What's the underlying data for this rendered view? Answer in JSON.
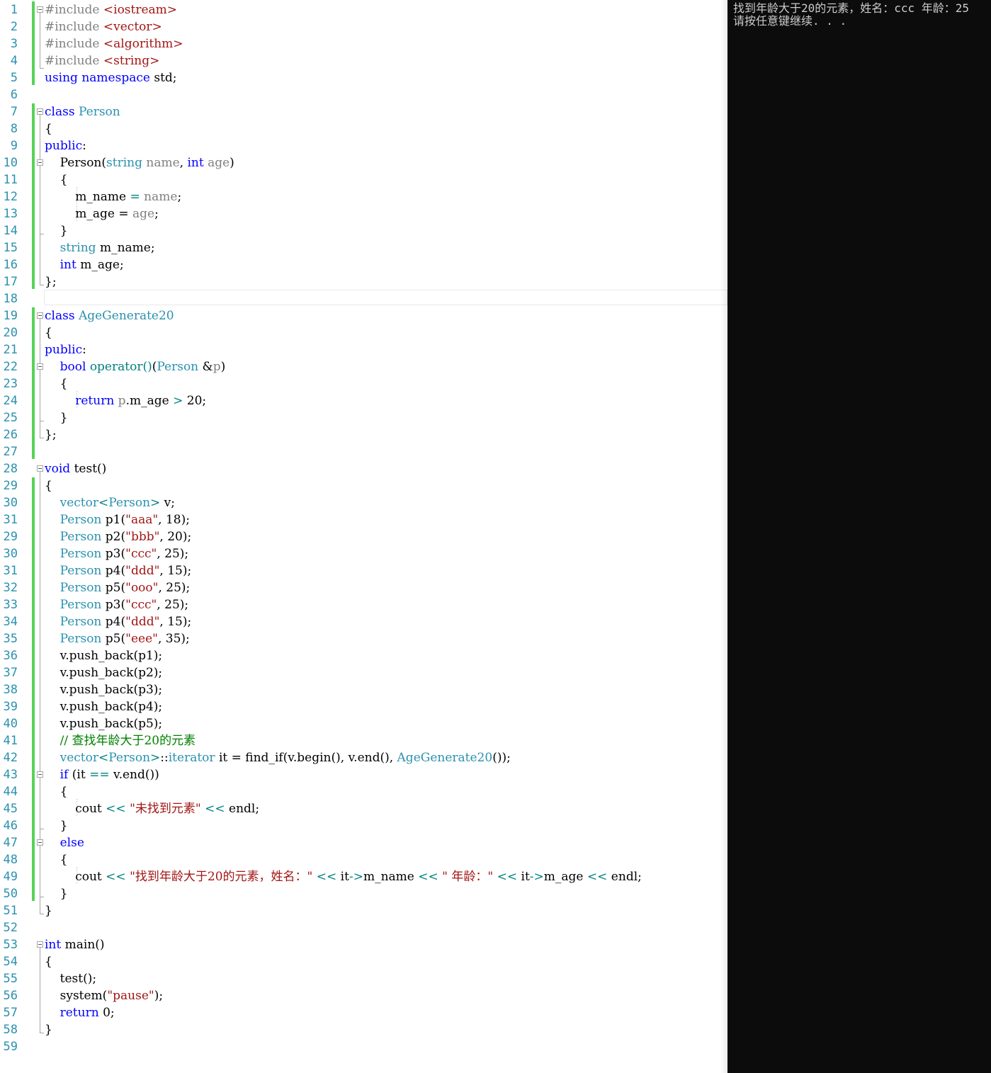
{
  "editor": {
    "lines": [
      {
        "num": "1",
        "tokens": [
          {
            "c": "pp",
            "t": "#include "
          },
          {
            "c": "inc",
            "t": "<iostream>"
          }
        ]
      },
      {
        "num": "2",
        "tokens": [
          {
            "c": "pp",
            "t": "#include "
          },
          {
            "c": "inc",
            "t": "<vector>"
          }
        ]
      },
      {
        "num": "3",
        "tokens": [
          {
            "c": "pp",
            "t": "#include "
          },
          {
            "c": "inc",
            "t": "<algorithm>"
          }
        ]
      },
      {
        "num": "4",
        "tokens": [
          {
            "c": "pp",
            "t": "#include "
          },
          {
            "c": "inc",
            "t": "<string>"
          }
        ]
      },
      {
        "num": "5",
        "tokens": [
          {
            "c": "kw",
            "t": "using namespace"
          },
          {
            "c": "pl",
            "t": " std;"
          }
        ]
      },
      {
        "num": "6",
        "tokens": []
      },
      {
        "num": "7",
        "tokens": [
          {
            "c": "kw",
            "t": "class "
          },
          {
            "c": "type",
            "t": "Person"
          }
        ]
      },
      {
        "num": "8",
        "tokens": [
          {
            "c": "pl",
            "t": "{"
          }
        ]
      },
      {
        "num": "9",
        "tokens": [
          {
            "c": "kw",
            "t": "public"
          },
          {
            "c": "pl",
            "t": ":"
          }
        ]
      },
      {
        "num": "10",
        "tokens": [
          {
            "c": "pl",
            "t": "    Person("
          },
          {
            "c": "type",
            "t": "string"
          },
          {
            "c": "par",
            "t": " name"
          },
          {
            "c": "pl",
            "t": ", "
          },
          {
            "c": "kw",
            "t": "int"
          },
          {
            "c": "par",
            "t": " age"
          },
          {
            "c": "pl",
            "t": ")"
          }
        ]
      },
      {
        "num": "11",
        "tokens": [
          {
            "c": "pl",
            "t": "    {"
          }
        ]
      },
      {
        "num": "12",
        "tokens": [
          {
            "c": "pl",
            "t": "        m_name "
          },
          {
            "c": "op",
            "t": "="
          },
          {
            "c": "par",
            "t": " name"
          },
          {
            "c": "pl",
            "t": ";"
          }
        ]
      },
      {
        "num": "13",
        "tokens": [
          {
            "c": "pl",
            "t": "        m_age = "
          },
          {
            "c": "par",
            "t": "age"
          },
          {
            "c": "pl",
            "t": ";"
          }
        ]
      },
      {
        "num": "14",
        "tokens": [
          {
            "c": "pl",
            "t": "    }"
          }
        ]
      },
      {
        "num": "15",
        "tokens": [
          {
            "c": "type",
            "t": "    string"
          },
          {
            "c": "pl",
            "t": " m_name;"
          }
        ]
      },
      {
        "num": "16",
        "tokens": [
          {
            "c": "kw",
            "t": "    int"
          },
          {
            "c": "pl",
            "t": " m_age;"
          }
        ]
      },
      {
        "num": "17",
        "tokens": [
          {
            "c": "pl",
            "t": "};"
          }
        ]
      },
      {
        "num": "18",
        "tokens": []
      },
      {
        "num": "19",
        "tokens": [
          {
            "c": "kw",
            "t": "class "
          },
          {
            "c": "type",
            "t": "AgeGenerate20"
          }
        ]
      },
      {
        "num": "20",
        "tokens": [
          {
            "c": "pl",
            "t": "{"
          }
        ]
      },
      {
        "num": "21",
        "tokens": [
          {
            "c": "kw",
            "t": "public"
          },
          {
            "c": "pl",
            "t": ":"
          }
        ]
      },
      {
        "num": "22",
        "tokens": [
          {
            "c": "kw",
            "t": "    bool"
          },
          {
            "c": "pl",
            "t": " "
          },
          {
            "c": "op",
            "t": "operator()"
          },
          {
            "c": "pl",
            "t": "("
          },
          {
            "c": "type",
            "t": "Person"
          },
          {
            "c": "pl",
            "t": " &"
          },
          {
            "c": "par",
            "t": "p"
          },
          {
            "c": "pl",
            "t": ")"
          }
        ]
      },
      {
        "num": "23",
        "tokens": [
          {
            "c": "pl",
            "t": "    {"
          }
        ]
      },
      {
        "num": "24",
        "tokens": [
          {
            "c": "kw",
            "t": "        return"
          },
          {
            "c": "par",
            "t": " p"
          },
          {
            "c": "pl",
            "t": ".m_age "
          },
          {
            "c": "op",
            "t": ">"
          },
          {
            "c": "pl",
            "t": " 20;"
          }
        ]
      },
      {
        "num": "25",
        "tokens": [
          {
            "c": "pl",
            "t": "    }"
          }
        ]
      },
      {
        "num": "26",
        "tokens": [
          {
            "c": "pl",
            "t": "};"
          }
        ]
      },
      {
        "num": "27",
        "tokens": []
      },
      {
        "num": "28",
        "tokens": [
          {
            "c": "kw",
            "t": "void"
          },
          {
            "c": "pl",
            "t": " test()"
          }
        ]
      },
      {
        "num": "29",
        "tokens": [
          {
            "c": "pl",
            "t": "{"
          }
        ]
      },
      {
        "num": "30",
        "tokens": [
          {
            "c": "type",
            "t": "    vector"
          },
          {
            "c": "op",
            "t": "<"
          },
          {
            "c": "type",
            "t": "Person"
          },
          {
            "c": "op",
            "t": ">"
          },
          {
            "c": "pl",
            "t": " v;"
          }
        ]
      },
      {
        "num": "31",
        "tokens": [
          {
            "c": "type",
            "t": "    Person"
          },
          {
            "c": "pl",
            "t": " p1("
          },
          {
            "c": "str",
            "t": "\"aaa\""
          },
          {
            "c": "pl",
            "t": ", 18);"
          }
        ]
      },
      {
        "num": "29",
        "tokens": [
          {
            "c": "type",
            "t": "    Person"
          },
          {
            "c": "pl",
            "t": " p2("
          },
          {
            "c": "str",
            "t": "\"bbb\""
          },
          {
            "c": "pl",
            "t": ", 20);"
          }
        ]
      },
      {
        "num": "30",
        "tokens": [
          {
            "c": "type",
            "t": "    Person"
          },
          {
            "c": "pl",
            "t": " p3("
          },
          {
            "c": "str",
            "t": "\"ccc\""
          },
          {
            "c": "pl",
            "t": ", 25);"
          }
        ]
      },
      {
        "num": "31",
        "tokens": [
          {
            "c": "type",
            "t": "    Person"
          },
          {
            "c": "pl",
            "t": " p4("
          },
          {
            "c": "str",
            "t": "\"ddd\""
          },
          {
            "c": "pl",
            "t": ", 15);"
          }
        ]
      },
      {
        "num": "32",
        "tokens": [
          {
            "c": "type",
            "t": "    Person"
          },
          {
            "c": "pl",
            "t": " p5("
          },
          {
            "c": "str",
            "t": "\"ooo\""
          },
          {
            "c": "pl",
            "t": ", 25);"
          }
        ]
      },
      {
        "num": "33",
        "tokens": [
          {
            "c": "type",
            "t": "    Person"
          },
          {
            "c": "pl",
            "t": " p3("
          },
          {
            "c": "str",
            "t": "\"ccc\""
          },
          {
            "c": "pl",
            "t": ", 25);"
          }
        ]
      },
      {
        "num": "34",
        "tokens": [
          {
            "c": "type",
            "t": "    Person"
          },
          {
            "c": "pl",
            "t": " p4("
          },
          {
            "c": "str",
            "t": "\"ddd\""
          },
          {
            "c": "pl",
            "t": ", 15);"
          }
        ]
      },
      {
        "num": "35",
        "tokens": [
          {
            "c": "type",
            "t": "    Person"
          },
          {
            "c": "pl",
            "t": " p5("
          },
          {
            "c": "str",
            "t": "\"eee\""
          },
          {
            "c": "pl",
            "t": ", 35);"
          }
        ]
      },
      {
        "num": "36",
        "tokens": [
          {
            "c": "pl",
            "t": "    v.push_back(p1);"
          }
        ]
      },
      {
        "num": "37",
        "tokens": [
          {
            "c": "pl",
            "t": "    v.push_back(p2);"
          }
        ]
      },
      {
        "num": "38",
        "tokens": [
          {
            "c": "pl",
            "t": "    v.push_back(p3);"
          }
        ]
      },
      {
        "num": "39",
        "tokens": [
          {
            "c": "pl",
            "t": "    v.push_back(p4);"
          }
        ]
      },
      {
        "num": "40",
        "tokens": [
          {
            "c": "pl",
            "t": "    v.push_back(p5);"
          }
        ]
      },
      {
        "num": "41",
        "tokens": [
          {
            "c": "cmt",
            "t": "    // 查找年龄大于20的元素"
          }
        ]
      },
      {
        "num": "42",
        "tokens": [
          {
            "c": "type",
            "t": "    vector"
          },
          {
            "c": "op",
            "t": "<"
          },
          {
            "c": "type",
            "t": "Person"
          },
          {
            "c": "op",
            "t": ">"
          },
          {
            "c": "pl",
            "t": "::"
          },
          {
            "c": "type",
            "t": "iterator"
          },
          {
            "c": "pl",
            "t": " it = find_if(v.begin(), v.end(), "
          },
          {
            "c": "type",
            "t": "AgeGenerate20"
          },
          {
            "c": "pl",
            "t": "());"
          }
        ]
      },
      {
        "num": "43",
        "tokens": [
          {
            "c": "kw",
            "t": "    if"
          },
          {
            "c": "pl",
            "t": " (it "
          },
          {
            "c": "op",
            "t": "=="
          },
          {
            "c": "pl",
            "t": " v.end())"
          }
        ]
      },
      {
        "num": "44",
        "tokens": [
          {
            "c": "pl",
            "t": "    {"
          }
        ]
      },
      {
        "num": "45",
        "tokens": [
          {
            "c": "pl",
            "t": "        cout "
          },
          {
            "c": "op",
            "t": "<<"
          },
          {
            "c": "pl",
            "t": " "
          },
          {
            "c": "str",
            "t": "\"未找到元素\""
          },
          {
            "c": "pl",
            "t": " "
          },
          {
            "c": "op",
            "t": "<<"
          },
          {
            "c": "pl",
            "t": " endl;"
          }
        ]
      },
      {
        "num": "46",
        "tokens": [
          {
            "c": "pl",
            "t": "    }"
          }
        ]
      },
      {
        "num": "47",
        "tokens": [
          {
            "c": "kw",
            "t": "    else"
          }
        ]
      },
      {
        "num": "48",
        "tokens": [
          {
            "c": "pl",
            "t": "    {"
          }
        ]
      },
      {
        "num": "49",
        "tokens": [
          {
            "c": "pl",
            "t": "        cout "
          },
          {
            "c": "op",
            "t": "<<"
          },
          {
            "c": "pl",
            "t": " "
          },
          {
            "c": "str",
            "t": "\"找到年龄大于20的元素，姓名：\""
          },
          {
            "c": "pl",
            "t": " "
          },
          {
            "c": "op",
            "t": "<<"
          },
          {
            "c": "pl",
            "t": " it"
          },
          {
            "c": "op",
            "t": "->"
          },
          {
            "c": "pl",
            "t": "m_name "
          },
          {
            "c": "op",
            "t": "<<"
          },
          {
            "c": "pl",
            "t": " "
          },
          {
            "c": "str",
            "t": "\" 年龄：\""
          },
          {
            "c": "pl",
            "t": " "
          },
          {
            "c": "op",
            "t": "<<"
          },
          {
            "c": "pl",
            "t": " it"
          },
          {
            "c": "op",
            "t": "->"
          },
          {
            "c": "pl",
            "t": "m_age "
          },
          {
            "c": "op",
            "t": "<<"
          },
          {
            "c": "pl",
            "t": " endl;"
          }
        ]
      },
      {
        "num": "50",
        "tokens": [
          {
            "c": "pl",
            "t": "    }"
          }
        ]
      },
      {
        "num": "51",
        "tokens": [
          {
            "c": "pl",
            "t": "}"
          }
        ]
      },
      {
        "num": "52",
        "tokens": []
      },
      {
        "num": "53",
        "tokens": [
          {
            "c": "kw",
            "t": "int"
          },
          {
            "c": "pl",
            "t": " main()"
          }
        ]
      },
      {
        "num": "54",
        "tokens": [
          {
            "c": "pl",
            "t": "{"
          }
        ]
      },
      {
        "num": "55",
        "tokens": [
          {
            "c": "pl",
            "t": "    test();"
          }
        ]
      },
      {
        "num": "56",
        "tokens": [
          {
            "c": "pl",
            "t": "    system("
          },
          {
            "c": "str",
            "t": "\"pause\""
          },
          {
            "c": "pl",
            "t": ");"
          }
        ]
      },
      {
        "num": "57",
        "tokens": [
          {
            "c": "kw",
            "t": "    return"
          },
          {
            "c": "pl",
            "t": " 0;"
          }
        ]
      },
      {
        "num": "58",
        "tokens": [
          {
            "c": "pl",
            "t": "}"
          }
        ]
      },
      {
        "num": "59",
        "tokens": []
      }
    ],
    "colors": {
      "keyword": "#0000ff",
      "type": "#2b91af",
      "string": "#a31515",
      "comment": "#008000",
      "line_number": "#2b91af",
      "change_bar": "#57d357"
    }
  },
  "console": {
    "lines": [
      "找到年龄大于20的元素，姓名：ccc 年龄：25",
      "请按任意键继续. . ."
    ],
    "background": "#0c0c0c",
    "foreground": "#cccccc"
  }
}
